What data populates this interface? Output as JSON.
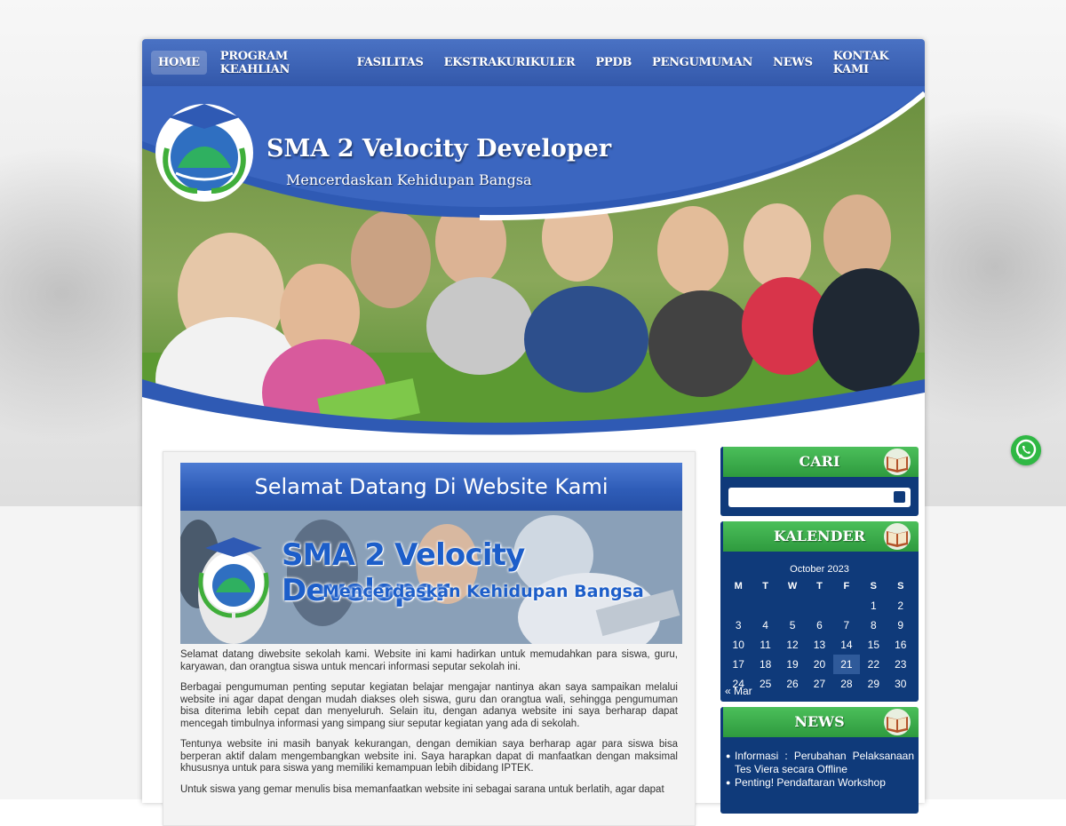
{
  "nav": {
    "items": [
      {
        "label": "HOME",
        "active": true
      },
      {
        "label": "PROGRAM KEAHLIAN"
      },
      {
        "label": "FASILITAS"
      },
      {
        "label": "EKSTRAKURIKULER"
      },
      {
        "label": "PPDB"
      },
      {
        "label": "PENGUMUMAN"
      },
      {
        "label": "NEWS"
      },
      {
        "label": "KONTAK KAMI"
      }
    ]
  },
  "header": {
    "title": "SMA 2 Velocity Developer",
    "tagline": "Mencerdaskan Kehidupan Bangsa"
  },
  "main": {
    "welcome_title": "Selamat Datang Di Website Kami",
    "banner_title": "SMA 2 Velocity Developer",
    "banner_tagline": "Mencerdaskan Kehidupan Bangsa",
    "paragraphs": [
      "Selamat datang diwebsite sekolah kami. Website ini kami hadirkan untuk memudahkan para siswa, guru, karyawan, dan orangtua siswa untuk mencari informasi seputar sekolah ini.",
      "Berbagai pengumuman penting seputar kegiatan belajar mengajar nantinya akan saya sampaikan melalui website ini agar dapat dengan mudah diakses oleh siswa, guru dan orangtua wali, sehingga pengumuman bisa diterima lebih cepat dan menyeluruh. Selain itu, dengan adanya website ini saya berharap dapat mencegah timbulnya informasi yang simpang siur seputar kegiatan yang ada di sekolah.",
      "Tentunya website ini masih banyak kekurangan, dengan demikian saya berharap agar para siswa bisa berperan aktif dalam mengembangkan website ini. Saya harapkan dapat di manfaatkan dengan maksimal khususnya untuk para siswa yang memiliki kemampuan lebih dibidang IPTEK.",
      "Untuk siswa yang gemar menulis bisa memanfaatkan website ini sebagai sarana untuk berlatih, agar dapat"
    ]
  },
  "sidebar": {
    "search": {
      "title": "CARI",
      "placeholder": ""
    },
    "calendar": {
      "title": "KALENDER",
      "caption": "October 2023",
      "weekdays": [
        "M",
        "T",
        "W",
        "T",
        "F",
        "S",
        "S"
      ],
      "weeks": [
        [
          "",
          "",
          "",
          "",
          "",
          "1",
          "2"
        ],
        [
          "3",
          "4",
          "5",
          "6",
          "7",
          "8",
          "9"
        ],
        [
          "10",
          "11",
          "12",
          "13",
          "14",
          "15",
          "16"
        ],
        [
          "17",
          "18",
          "19",
          "20",
          "21",
          "22",
          "23"
        ],
        [
          "24",
          "25",
          "26",
          "27",
          "28",
          "29",
          "30"
        ]
      ],
      "today": "21",
      "prev_label": "« Mar"
    },
    "news": {
      "title": "NEWS",
      "items": [
        "Informasi : Perubahan Pelaksanaan Tes Viera secara Offline",
        "Penting! Pendaftaran Workshop"
      ]
    }
  },
  "colors": {
    "nav": "#3a63b8",
    "widget": "#0f3a7a",
    "widget_head": "#2e9a3e",
    "whatsapp": "#2fb844"
  }
}
